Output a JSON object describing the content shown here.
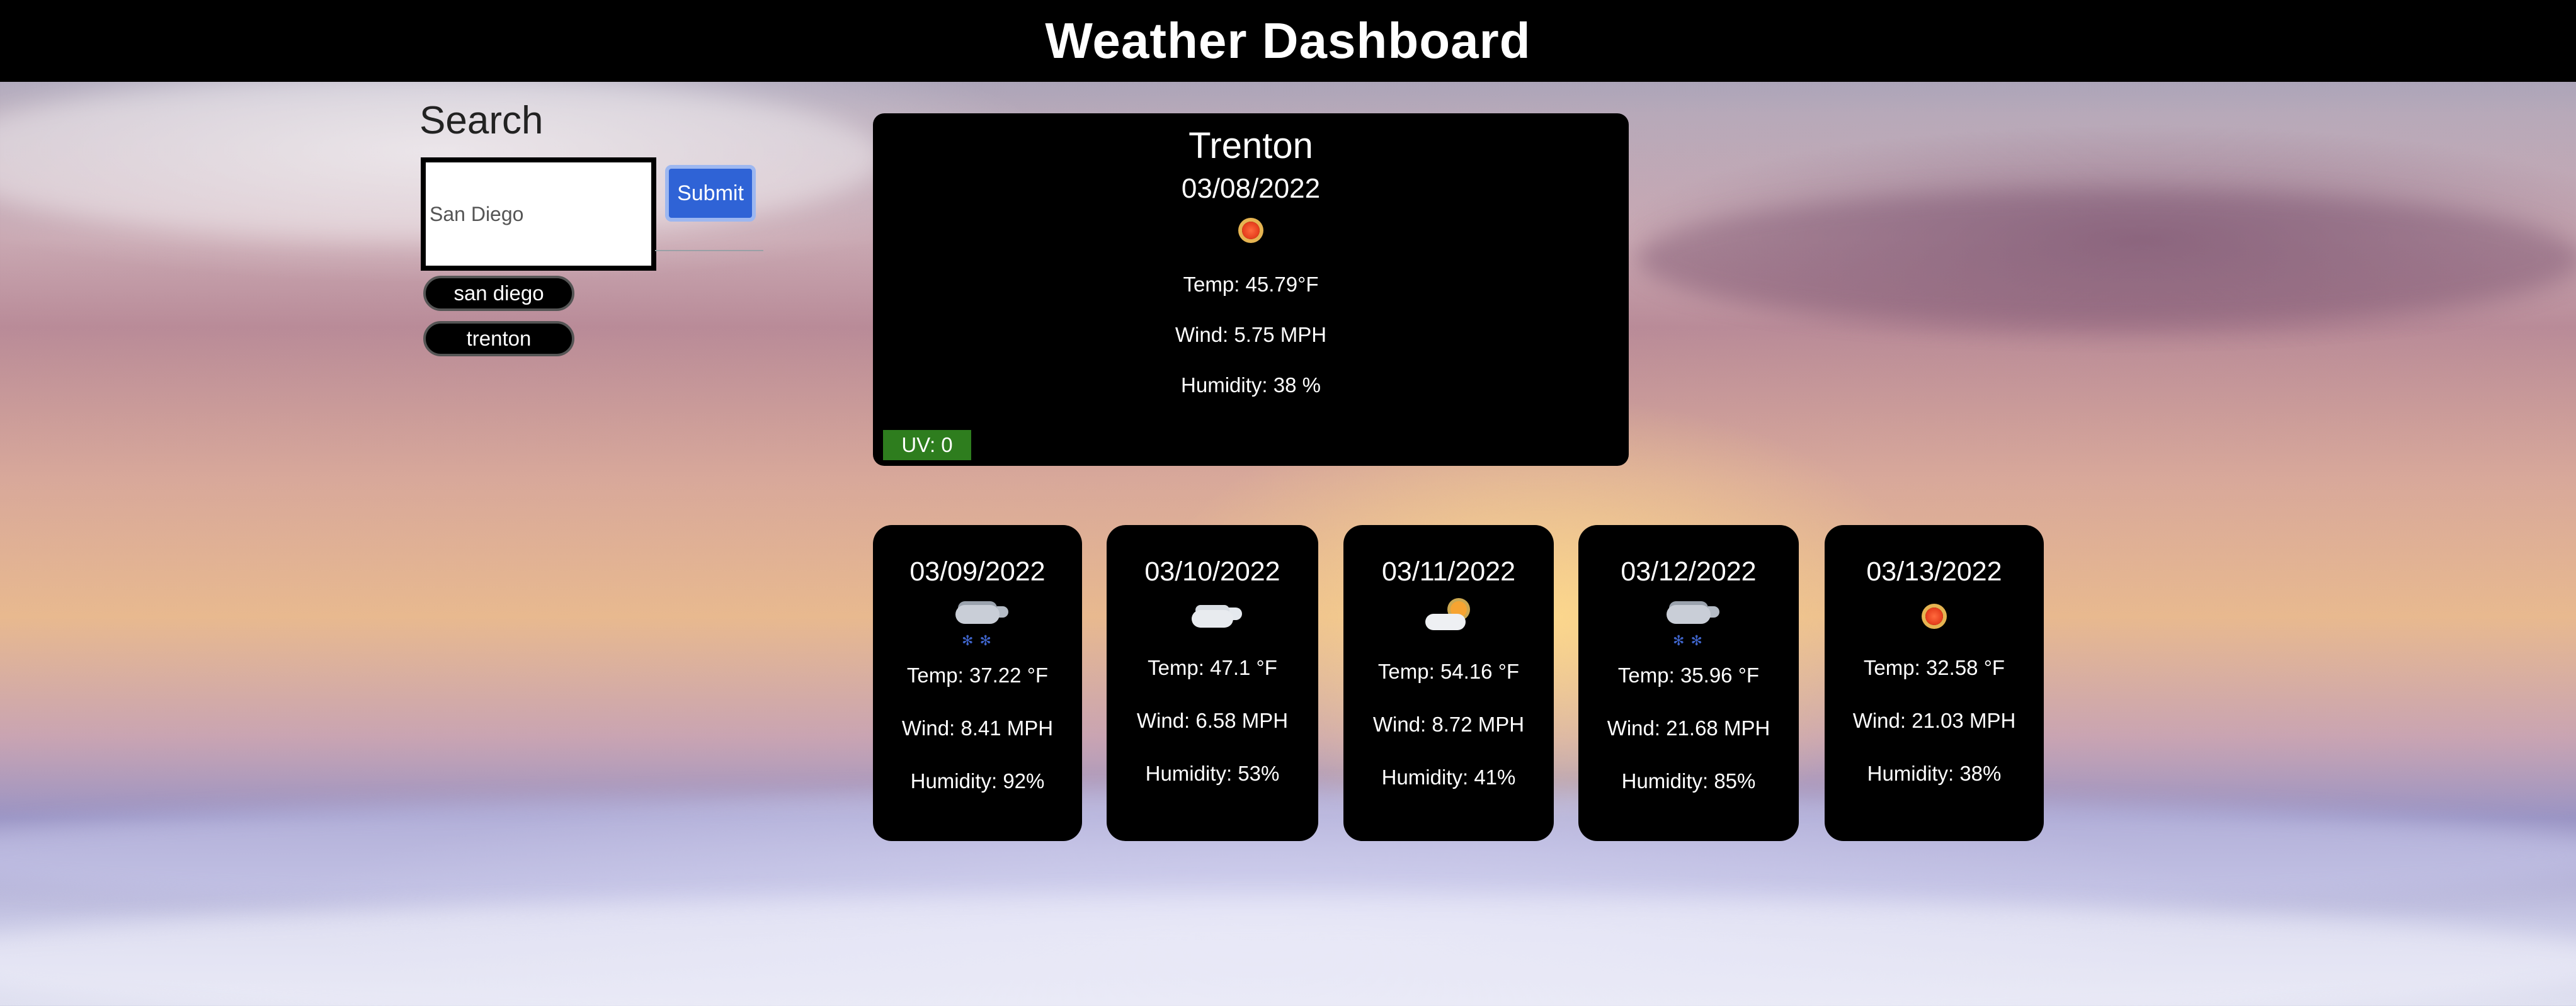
{
  "header": {
    "title": "Weather Dashboard"
  },
  "search": {
    "title": "Search",
    "placeholder": "San Diego",
    "submit_label": "Submit",
    "history": [
      "san diego",
      "trenton"
    ]
  },
  "current": {
    "city": "Trenton",
    "date": "03/08/2022",
    "icon": "sun-icon",
    "temp": "Temp: 45.79°F",
    "wind": "Wind: 5.75 MPH",
    "humidity": "Humidity: 38 %",
    "uv": "UV: 0",
    "uv_color": "#2e7d1e"
  },
  "forecast": [
    {
      "date": "03/09/2022",
      "icon": "snow-cloud-icon",
      "temp": "Temp: 37.22 °F",
      "wind": "Wind: 8.41 MPH",
      "humidity": "Humidity: 92%"
    },
    {
      "date": "03/10/2022",
      "icon": "cloud-icon",
      "temp": "Temp: 47.1 °F",
      "wind": "Wind: 6.58 MPH",
      "humidity": "Humidity: 53%"
    },
    {
      "date": "03/11/2022",
      "icon": "partly-cloudy-icon",
      "temp": "Temp: 54.16 °F",
      "wind": "Wind: 8.72 MPH",
      "humidity": "Humidity: 41%"
    },
    {
      "date": "03/12/2022",
      "icon": "snow-cloud-icon",
      "temp": "Temp: 35.96 °F",
      "wind": "Wind: 21.68 MPH",
      "humidity": "Humidity: 85%"
    },
    {
      "date": "03/13/2022",
      "icon": "sun-icon",
      "temp": "Temp: 32.58 °F",
      "wind": "Wind: 21.03 MPH",
      "humidity": "Humidity: 38%"
    }
  ],
  "colors": {
    "header_bg": "#000000",
    "card_bg": "#000000",
    "submit_bg": "#2f63d6",
    "uv_bg": "#2e7d1e"
  }
}
